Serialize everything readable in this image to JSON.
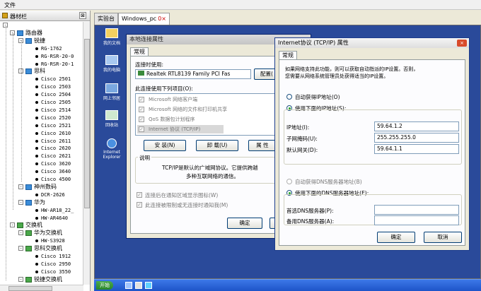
{
  "menubar": {
    "file": "文件"
  },
  "left_panel": {
    "title": "器材栏",
    "close": "⊠",
    "tree": [
      {
        "level": 0,
        "kind": "expander",
        "exp": "-",
        "label": ""
      },
      {
        "level": 1,
        "kind": "folder",
        "exp": "-",
        "label": "路由器"
      },
      {
        "level": 2,
        "kind": "folder",
        "exp": "-",
        "label": "锐捷"
      },
      {
        "level": 3,
        "kind": "leaf",
        "label": "RG-1762"
      },
      {
        "level": 3,
        "kind": "leaf",
        "label": "RG-RSR-20-0"
      },
      {
        "level": 3,
        "kind": "leaf",
        "label": "RG-RSR-20-1"
      },
      {
        "level": 2,
        "kind": "folder",
        "exp": "-",
        "label": "思科"
      },
      {
        "level": 3,
        "kind": "leaf",
        "label": "Cisco 2501"
      },
      {
        "level": 3,
        "kind": "leaf",
        "label": "Cisco 2503"
      },
      {
        "level": 3,
        "kind": "leaf",
        "label": "Cisco 2504"
      },
      {
        "level": 3,
        "kind": "leaf",
        "label": "Cisco 2505"
      },
      {
        "level": 3,
        "kind": "leaf",
        "label": "Cisco 2514"
      },
      {
        "level": 3,
        "kind": "leaf",
        "label": "Cisco 2520"
      },
      {
        "level": 3,
        "kind": "leaf",
        "label": "Cisco 2521"
      },
      {
        "level": 3,
        "kind": "leaf",
        "label": "Cisco 2610"
      },
      {
        "level": 3,
        "kind": "leaf",
        "label": "Cisco 2611"
      },
      {
        "level": 3,
        "kind": "leaf",
        "label": "Cisco 2620"
      },
      {
        "level": 3,
        "kind": "leaf",
        "label": "Cisco 2621"
      },
      {
        "level": 3,
        "kind": "leaf",
        "label": "Cisco 3620"
      },
      {
        "level": 3,
        "kind": "leaf",
        "label": "Cisco 3640"
      },
      {
        "level": 3,
        "kind": "leaf",
        "label": "Cisco 4500"
      },
      {
        "level": 2,
        "kind": "folder",
        "exp": "-",
        "label": "神州数码"
      },
      {
        "level": 3,
        "kind": "leaf",
        "label": "DCR-2626"
      },
      {
        "level": 2,
        "kind": "folder",
        "exp": "-",
        "label": "华为"
      },
      {
        "level": 3,
        "kind": "leaf",
        "label": "HW-AR18_22_"
      },
      {
        "level": 3,
        "kind": "leaf",
        "label": "HW-AR4640"
      },
      {
        "level": 1,
        "kind": "folder-sw",
        "exp": "-",
        "label": "交换机"
      },
      {
        "level": 2,
        "kind": "folder-sw",
        "exp": "-",
        "label": "华为交换机"
      },
      {
        "level": 3,
        "kind": "leaf",
        "label": "HW-S3928"
      },
      {
        "level": 2,
        "kind": "folder-sw",
        "exp": "-",
        "label": "思科交换机"
      },
      {
        "level": 3,
        "kind": "leaf",
        "label": "Cisco 1912"
      },
      {
        "level": 3,
        "kind": "leaf",
        "label": "Cisco 2950"
      },
      {
        "level": 3,
        "kind": "leaf",
        "label": "Cisco 3550"
      },
      {
        "level": 2,
        "kind": "folder-sw",
        "exp": "-",
        "label": "锐捷交换机"
      }
    ]
  },
  "tabs": [
    {
      "label": "实验台",
      "active": false
    },
    {
      "label": "Windows_pc",
      "close": "0×",
      "active": true
    }
  ],
  "desktop_icons": [
    {
      "label": "我的文档"
    },
    {
      "label": "我的电脑"
    },
    {
      "label": "网上邻居"
    },
    {
      "label": "回收站"
    },
    {
      "label": "Internet Explorer"
    }
  ],
  "taskbar": {
    "start": "开始"
  },
  "local_conn": {
    "title": "本地连接属性",
    "tab": "常规",
    "connect_using": "连接时使用:",
    "adapter": "Realtek RTL8139 Family PCI Fas",
    "configure": "配置(",
    "items_label": "此连接使用下列项目(O):",
    "items": [
      {
        "label": "Microsoft 网络客户端"
      },
      {
        "label": "Microsoft 网络的文件和打印机共享"
      },
      {
        "label": "QoS 数据包计划程序"
      },
      {
        "label": "Internet 协议 (TCP/IP)"
      }
    ],
    "install": "安 装(N)",
    "uninstall": "卸 载(U)",
    "properties": "属 性",
    "desc_title": "说明",
    "desc_1": "TCP/IP是默认的广域网协议。它提供跨越",
    "desc_2": "多种互联网络的通信。",
    "show_icon": "连接后在通知区域显示图标(W)",
    "notify": "此连接被限制或无连接时通知我(M)",
    "ok": "确定"
  },
  "tcpip": {
    "title": "Internet协议 (TCP/IP) 属性",
    "close": "×",
    "tab": "常规",
    "intro_1": "如果网络支持此功能，则可以获取自动指派的IP设置。否则，",
    "intro_2": "您需要从网络系统管理员处获得适当的IP设置。",
    "auto_ip": "自动获得IP地址(O)",
    "use_ip": "使用下面的IP地址(S):",
    "ip_label": "IP地址(I):",
    "ip_value": "59.64.1.2",
    "mask_label": "子网掩码(U):",
    "mask_value": "255.255.255.0",
    "gw_label": "默认网关(D):",
    "gw_value": "59.64.1.1",
    "auto_dns": "自动获得DNS服务器地址(B)",
    "use_dns": "使用下面的DNS服务器地址(E):",
    "pref_dns_label": "首选DNS服务器(P):",
    "pref_dns_value": "",
    "alt_dns_label": "备用DNS服务器(A):",
    "alt_dns_value": "",
    "ok": "确定",
    "cancel": "取消"
  }
}
